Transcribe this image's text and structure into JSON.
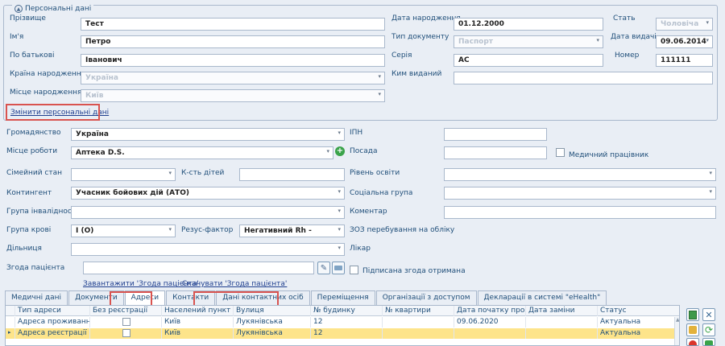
{
  "personal": {
    "legend": "Персональні дані",
    "surname_label": "Прізвище",
    "surname": "Тест",
    "name_label": "Ім'я",
    "name": "Петро",
    "patronymic_label": "По батькові",
    "patronymic": "Іванович",
    "birth_country_label": "Країна народження",
    "birth_country": "Україна",
    "birth_place_label": "Місце народження",
    "birth_place": "Київ",
    "birth_date_label": "Дата народження",
    "birth_date": "01.12.2000",
    "doc_type_label": "Тип документу",
    "doc_type": "Паспорт",
    "series_label": "Серія",
    "series": "АС",
    "issued_by_label": "Ким виданий",
    "issued_by": "",
    "sex_label": "Стать",
    "sex": "Чоловіча",
    "issue_date_label": "Дата видачі",
    "issue_date": "09.06.2014",
    "number_label": "Номер",
    "number": "111111",
    "change_link": "Змінити персональні дані"
  },
  "form": {
    "citizenship_label": "Громадянство",
    "citizenship": "Україна",
    "workplace_label": "Місце роботи",
    "workplace": "Аптека D.S.",
    "marital_label": "Сімейний стан",
    "marital": "",
    "children_label": "К-сть дітей",
    "children": "",
    "contingent_label": "Контингент",
    "contingent": "Учасник бойових дій (АТО)",
    "disability_label": "Група інвалідності",
    "disability": "",
    "blood_label": "Група крові",
    "blood": "I (O)",
    "rh_label": "Резус-фактор",
    "rh": "Негативний Rh -",
    "district_label": "Дільниця",
    "district": "",
    "consent_label": "Згода пацієнта",
    "consent": "",
    "ipn_label": "ІПН",
    "ipn": "",
    "position_label": "Посада",
    "position": "",
    "medic_label": "Медичний працівник",
    "education_label": "Рівень освіти",
    "education": "",
    "social_label": "Соціальна група",
    "social": "",
    "comment_label": "Коментар",
    "comment": "",
    "zoz_label": "ЗОЗ перебування на обліку",
    "doctor_label": "Лікар",
    "consent_signed_label": "Підписана згода отримана",
    "upload_link": "Завантажити 'Згода пацієнта'",
    "scan_link": "Сканувати 'Згода пацієнта'"
  },
  "tabs": [
    "Медичні дані",
    "Документи",
    "Адреси",
    "Контакти",
    "Дані контактних осіб",
    "Переміщення",
    "Організації з доступом",
    "Декларації в системі \"eHealth\""
  ],
  "grid": {
    "columns": [
      "Тип адреси",
      "Без реєстрації",
      "Населений пункт",
      "Вулиця",
      "№ будинку",
      "№ квартири",
      "Дата початку прожив",
      "Дата заміни",
      "Статус"
    ],
    "rows": [
      [
        "Адреса проживання",
        "",
        "Київ",
        "Лукянівська",
        "12",
        "",
        "09.06.2020",
        "",
        "Актуальна"
      ],
      [
        "Адреса реєстрації",
        "",
        "Київ",
        "Лукянівська",
        "12",
        "",
        "",
        "",
        "Актуальна"
      ]
    ]
  },
  "colors": {
    "accent": "#1f4e79",
    "highlight": "#d9534f",
    "selected_row": "#fde48a"
  }
}
